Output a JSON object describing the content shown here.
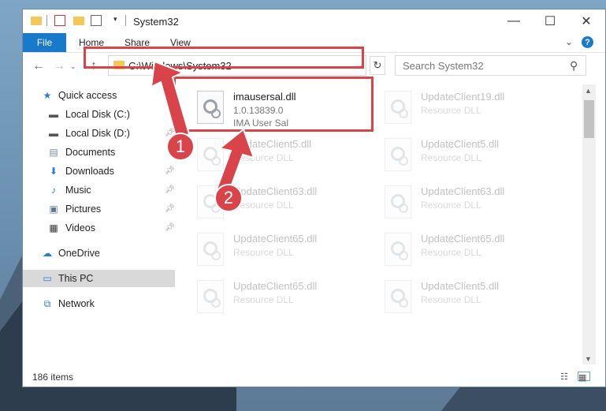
{
  "window": {
    "title": "System32"
  },
  "ribbon": {
    "tabs": [
      "File",
      "Home",
      "Share",
      "View"
    ],
    "help": "?"
  },
  "nav": {
    "address": "C:\\Windows\\System32",
    "search_placeholder": "Search System32"
  },
  "sidebar": {
    "items": [
      {
        "label": "Quick access",
        "icon": "star-icon"
      },
      {
        "label": "Local Disk (C:)",
        "icon": "drive-icon"
      },
      {
        "label": "Local Disk (D:)",
        "icon": "drive-icon"
      },
      {
        "label": "Documents",
        "icon": "documents-icon"
      },
      {
        "label": "Downloads",
        "icon": "download-icon"
      },
      {
        "label": "Music",
        "icon": "music-icon"
      },
      {
        "label": "Pictures",
        "icon": "pictures-icon"
      },
      {
        "label": "Videos",
        "icon": "videos-icon"
      },
      {
        "label": "OneDrive",
        "icon": "cloud-icon"
      },
      {
        "label": "This PC",
        "icon": "pc-icon"
      },
      {
        "label": "Network",
        "icon": "network-icon"
      }
    ]
  },
  "files": [
    {
      "name": "imausersal.dll",
      "line1": "1.0.13839.0",
      "line2": "IMA User Sal"
    },
    {
      "name": "UpdateClient19.dll",
      "line1": "Resource DLL"
    },
    {
      "name": "UpdateClient5.dll",
      "line1": "Resource DLL"
    },
    {
      "name": "UpdateClient5.dll",
      "line1": "Resource DLL"
    },
    {
      "name": "UpdateClient63.dll",
      "line1": "Resource DLL"
    },
    {
      "name": "UpdateClient63.dll",
      "line1": "Resource DLL"
    },
    {
      "name": "UpdateClient65.dll",
      "line1": "Resource DLL"
    },
    {
      "name": "UpdateClient65.dll",
      "line1": "Resource DLL"
    },
    {
      "name": "UpdateClient65.dll",
      "line1": "Resource DLL"
    },
    {
      "name": "UpdateClient5.dll",
      "line1": "Resource DLL"
    }
  ],
  "status": {
    "items": "186 items"
  },
  "annotations": {
    "badge1": "1",
    "badge2": "2"
  },
  "colors": {
    "accent": "#1979ca",
    "highlight": "#d9434a"
  }
}
